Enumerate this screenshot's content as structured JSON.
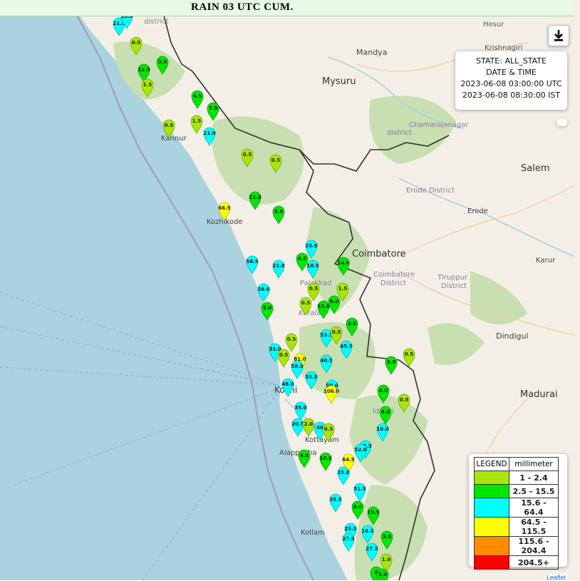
{
  "title": "RAIN 03 UTC CUM.",
  "info": {
    "state": "STATE: ALL_STATE",
    "heading": "DATE & TIME",
    "utc": "2023-06-08 03:00:00 UTC",
    "ist": "2023-06-08 08:30:00 IST"
  },
  "legend": {
    "header_left": "LEGEND",
    "header_right": "millimeter",
    "rows": [
      {
        "label": "1 - 2.4",
        "color": "#a8e60a"
      },
      {
        "label": "2.5 - 15.5",
        "color": "#00e600"
      },
      {
        "label": "15.6 - 64.4",
        "color": "#00ffff"
      },
      {
        "label": "64.5 - 115.5",
        "color": "#ffff00"
      },
      {
        "label": "115.6 - 204.4",
        "color": "#ff8c00"
      },
      {
        "label": "204.5+",
        "color": "#ff0000"
      }
    ]
  },
  "attribution": "Leaflet",
  "place_labels": [
    "district",
    "Hosur",
    "Krishnagiri",
    "Mandya",
    "Mysuru",
    "Chamarajanagar",
    "district",
    "Kannur",
    "Salem",
    "Erode District",
    "Erode",
    "Kozhikode",
    "Coimbatore",
    "Coimbatore",
    "District",
    "Tiruppur",
    "District",
    "Karur",
    "Palakkad",
    "Kerala",
    "Dindigul",
    "Kochi",
    "Madurai",
    "Idukki",
    "Kottayam",
    "Alappuzha",
    "Kollam"
  ],
  "markers": [
    {
      "v": "21.5",
      "color": "cyan"
    },
    {
      "v": "18.0",
      "color": "cyan"
    },
    {
      "v": "0.5",
      "color": "lime"
    },
    {
      "v": "3.5",
      "color": "green"
    },
    {
      "v": "12.0",
      "color": "green"
    },
    {
      "v": "1.5",
      "color": "lime"
    },
    {
      "v": "4.5",
      "color": "green"
    },
    {
      "v": "7.5",
      "color": "green"
    },
    {
      "v": "1.5",
      "color": "lime"
    },
    {
      "v": "0.5",
      "color": "lime"
    },
    {
      "v": "21.0",
      "color": "cyan"
    },
    {
      "v": "0.5",
      "color": "lime"
    },
    {
      "v": "0.5",
      "color": "lime"
    },
    {
      "v": "11.0",
      "color": "green"
    },
    {
      "v": "66.5",
      "color": "yellow"
    },
    {
      "v": "5.5",
      "color": "green"
    },
    {
      "v": "25.0",
      "color": "cyan"
    },
    {
      "v": "58.5",
      "color": "cyan"
    },
    {
      "v": "21.0",
      "color": "cyan"
    },
    {
      "v": "4.5",
      "color": "green"
    },
    {
      "v": "18.5",
      "color": "cyan"
    },
    {
      "v": "14.0",
      "color": "green"
    },
    {
      "v": "38.0",
      "color": "cyan"
    },
    {
      "v": "0.5",
      "color": "lime"
    },
    {
      "v": "1.5",
      "color": "lime"
    },
    {
      "v": "5.0",
      "color": "green"
    },
    {
      "v": "0.5",
      "color": "lime"
    },
    {
      "v": "10.0",
      "color": "green"
    },
    {
      "v": "6.0",
      "color": "green"
    },
    {
      "v": "2.5",
      "color": "green"
    },
    {
      "v": "53.5",
      "color": "cyan"
    },
    {
      "v": "0.5",
      "color": "lime"
    },
    {
      "v": "0.5",
      "color": "lime"
    },
    {
      "v": "45.0",
      "color": "cyan"
    },
    {
      "v": "35.0",
      "color": "cyan"
    },
    {
      "v": "0.5",
      "color": "lime"
    },
    {
      "v": "81.0",
      "color": "yellow"
    },
    {
      "v": "0.5",
      "color": "lime"
    },
    {
      "v": "40.5",
      "color": "cyan"
    },
    {
      "v": "5.0",
      "color": "green"
    },
    {
      "v": "58.0",
      "color": "cyan"
    },
    {
      "v": "55.5",
      "color": "cyan"
    },
    {
      "v": "48.0",
      "color": "cyan"
    },
    {
      "v": "50.0",
      "color": "cyan"
    },
    {
      "v": "106.0",
      "color": "yellow"
    },
    {
      "v": "4.0",
      "color": "green"
    },
    {
      "v": "0.5",
      "color": "lime"
    },
    {
      "v": "35.0",
      "color": "cyan"
    },
    {
      "v": "4.0",
      "color": "green"
    },
    {
      "v": "20.5",
      "color": "cyan"
    },
    {
      "v": "2.0",
      "color": "lime"
    },
    {
      "v": "46",
      "color": "cyan"
    },
    {
      "v": "0.5",
      "color": "lime"
    },
    {
      "v": "18.0",
      "color": "cyan"
    },
    {
      "v": "47.5",
      "color": "cyan"
    },
    {
      "v": "52.0",
      "color": "cyan"
    },
    {
      "v": "4.5",
      "color": "green"
    },
    {
      "v": "10.5",
      "color": "green"
    },
    {
      "v": "64.5",
      "color": "yellow"
    },
    {
      "v": "25.0",
      "color": "cyan"
    },
    {
      "v": "51.5",
      "color": "cyan"
    },
    {
      "v": "35.5",
      "color": "cyan"
    },
    {
      "v": "6.0",
      "color": "green"
    },
    {
      "v": "15.5",
      "color": "green"
    },
    {
      "v": "25.5",
      "color": "cyan"
    },
    {
      "v": "16.5",
      "color": "cyan"
    },
    {
      "v": "27.5",
      "color": "cyan"
    },
    {
      "v": "3.0",
      "color": "green"
    },
    {
      "v": "27.5",
      "color": "cyan"
    },
    {
      "v": "1.0",
      "color": "lime"
    },
    {
      "v": "9",
      "color": "green"
    },
    {
      "v": "3.0",
      "color": "green"
    }
  ]
}
